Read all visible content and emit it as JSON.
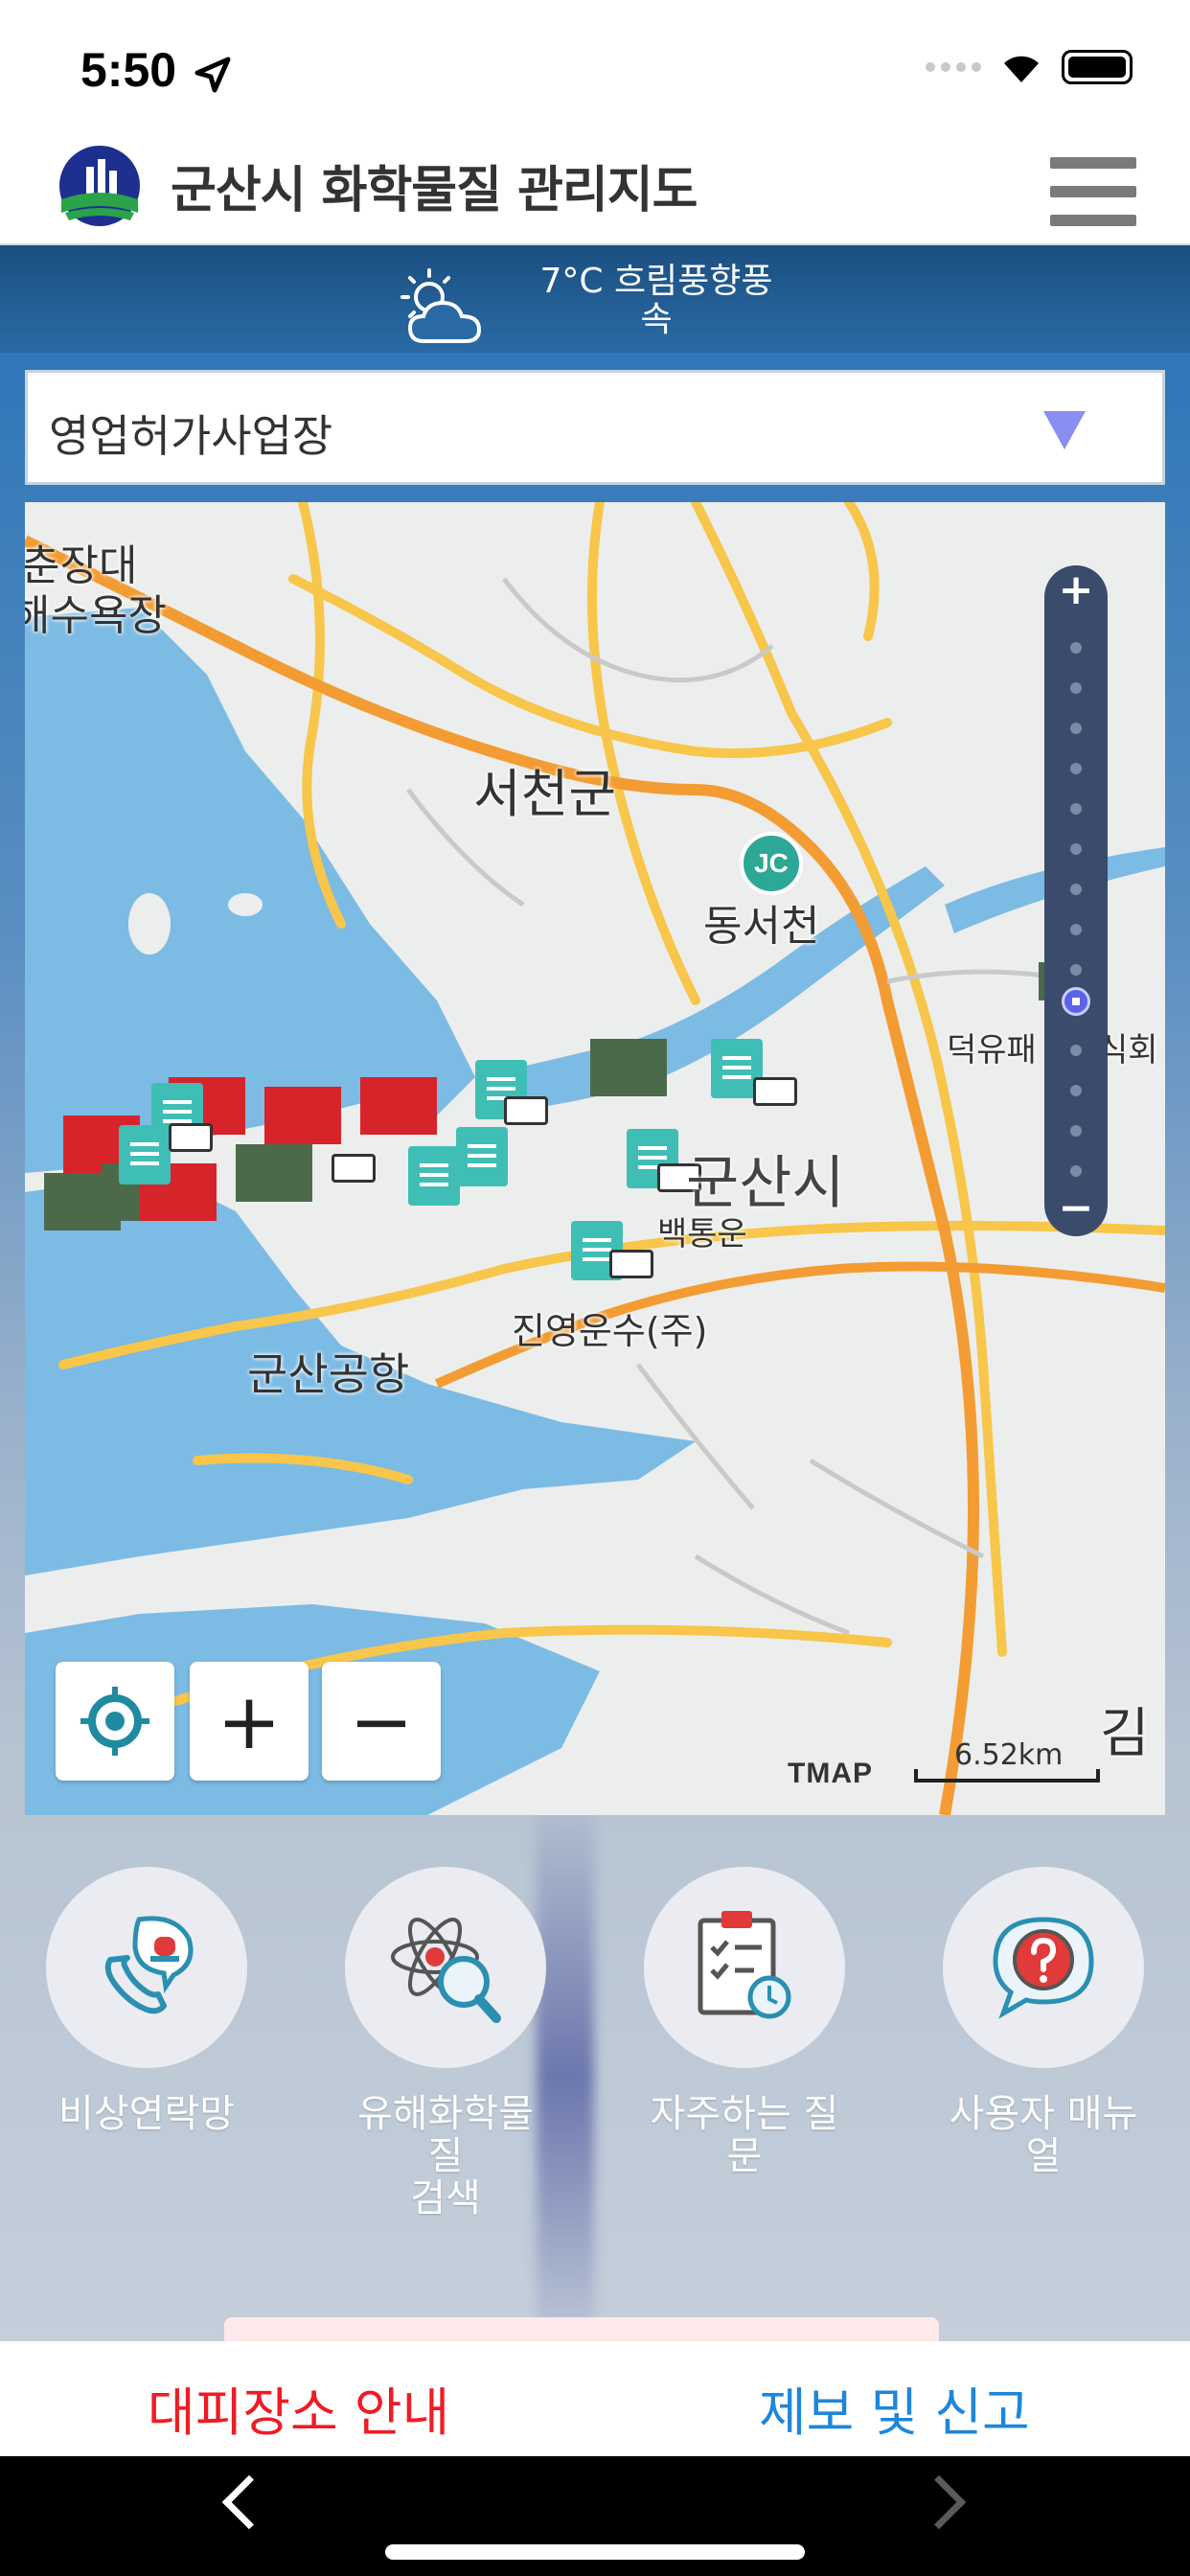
{
  "status_bar": {
    "time": "5:50"
  },
  "header": {
    "app_title": "군산시 화학물질 관리지도"
  },
  "weather": {
    "line1": "7°C 흐림풍향풍",
    "line2": "속"
  },
  "category_select": {
    "selected": "영업허가사업장"
  },
  "map": {
    "labels": {
      "top_left_1": "춘장대",
      "top_left_2": "해수욕장",
      "seocheon": "서천군",
      "jc": "JC",
      "dongseocheon": "동서천",
      "deokyu": "덕유패",
      "deokyu2": "식회",
      "gunsan_city": "군산시",
      "jinyoung": "진영운수(주)",
      "airport": "군산공항",
      "baekunyun": "백통운",
      "gim": "김"
    },
    "scale": "6.52km",
    "provider": "TMAP",
    "zoom_in": "+",
    "zoom_out": "−",
    "slider_plus": "+",
    "slider_minus": "−"
  },
  "quick_menu": [
    {
      "label_line1": "비상연락망",
      "label_line2": ""
    },
    {
      "label_line1": "유해화학물질",
      "label_line2": "검색"
    },
    {
      "label_line1": "자주하는 질",
      "label_line2": "문"
    },
    {
      "label_line1": "사용자 매뉴",
      "label_line2": "얼"
    }
  ],
  "action_bar": {
    "left": "대피장소 안내",
    "right": "제보 및 신고"
  },
  "colors": {
    "accent_red": "#ee1c24",
    "accent_blue": "#1f86d9",
    "marker_teal": "#3fbeb6",
    "marker_red": "#d7232a",
    "marker_green": "#4c6a4a"
  }
}
